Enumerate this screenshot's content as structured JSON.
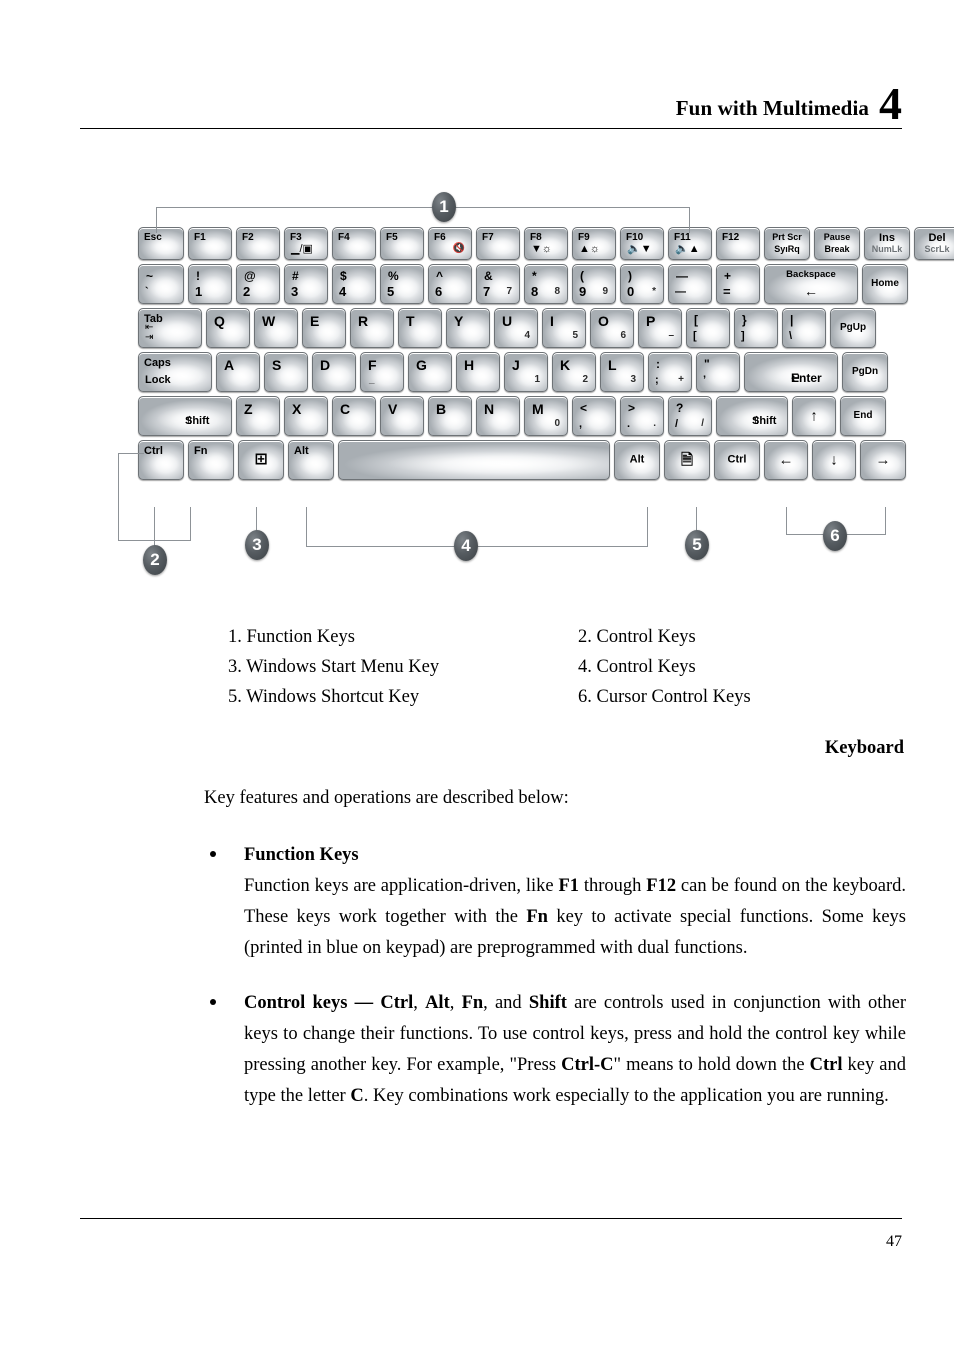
{
  "header": {
    "title": "Fun with Multimedia",
    "chapter": "4"
  },
  "footer": {
    "page_number": "47"
  },
  "figure": {
    "caption": "Keyboard",
    "callouts": [
      "1",
      "2",
      "3",
      "4",
      "5",
      "6"
    ],
    "keyboard": {
      "row_fn": [
        {
          "name": "esc",
          "main": "Esc"
        },
        {
          "name": "f1",
          "main": "F1"
        },
        {
          "name": "f2",
          "main": "F2"
        },
        {
          "name": "f3",
          "main": "F3",
          "icon": "display-switch"
        },
        {
          "name": "f4",
          "main": "F4"
        },
        {
          "name": "f5",
          "main": "F5"
        },
        {
          "name": "f6",
          "main": "F6",
          "icon": "speaker-mute"
        },
        {
          "name": "f7",
          "main": "F7"
        },
        {
          "name": "f8",
          "main": "F8",
          "icon": "brightness-down"
        },
        {
          "name": "f9",
          "main": "F9",
          "icon": "brightness-up"
        },
        {
          "name": "f10",
          "main": "F10",
          "icon": "volume-down"
        },
        {
          "name": "f11",
          "main": "F11",
          "icon": "volume-up"
        },
        {
          "name": "f12",
          "main": "F12"
        },
        {
          "name": "prtscr",
          "top": "Prt Scr",
          "bottom": "SyıRq"
        },
        {
          "name": "pause",
          "top": "Pause",
          "bottom": "Break"
        },
        {
          "name": "insert",
          "top": "Ins",
          "bottom": "NumLk"
        },
        {
          "name": "delete",
          "top": "Del",
          "bottom": "ScrLk"
        }
      ],
      "row_num": [
        {
          "name": "tilde",
          "top": "~",
          "bottom": "`"
        },
        {
          "name": "key-1",
          "top": "!",
          "bottom": "1"
        },
        {
          "name": "key-2",
          "top": "@",
          "bottom": "2"
        },
        {
          "name": "key-3",
          "top": "#",
          "bottom": "3"
        },
        {
          "name": "key-4",
          "top": "$",
          "bottom": "4"
        },
        {
          "name": "key-5",
          "top": "%",
          "bottom": "5"
        },
        {
          "name": "key-6",
          "top": "^",
          "bottom": "6"
        },
        {
          "name": "key-7",
          "top": "&",
          "bottom": "7",
          "alt": "7"
        },
        {
          "name": "key-8",
          "top": "*",
          "bottom": "8",
          "alt": "8"
        },
        {
          "name": "key-9",
          "top": "(",
          "bottom": "9",
          "alt": "9"
        },
        {
          "name": "key-0",
          "top": ")",
          "bottom": "0",
          "alt": "*"
        },
        {
          "name": "minus",
          "top": "—",
          "bottom": "—"
        },
        {
          "name": "equal",
          "top": "+",
          "bottom": "="
        },
        {
          "name": "backspace",
          "main": "Backspace",
          "icon": "arrow-left"
        },
        {
          "name": "home",
          "main": "Home"
        }
      ],
      "row_q": [
        {
          "name": "tab",
          "main": "Tab",
          "icon": "tab-arrows"
        },
        {
          "name": "key-q",
          "main": "Q"
        },
        {
          "name": "key-w",
          "main": "W"
        },
        {
          "name": "key-e",
          "main": "E"
        },
        {
          "name": "key-r",
          "main": "R"
        },
        {
          "name": "key-t",
          "main": "T"
        },
        {
          "name": "key-y",
          "main": "Y"
        },
        {
          "name": "key-u",
          "main": "U",
          "alt": "4"
        },
        {
          "name": "key-i",
          "main": "I",
          "alt": "5"
        },
        {
          "name": "key-o",
          "main": "O",
          "alt": "6"
        },
        {
          "name": "key-p",
          "main": "P",
          "alt": "–"
        },
        {
          "name": "bracket-left",
          "top": "[",
          "bottom": "["
        },
        {
          "name": "bracket-right",
          "top": "}",
          "bottom": "]"
        },
        {
          "name": "backslash",
          "top": "|",
          "bottom": "\\"
        },
        {
          "name": "pgup",
          "main": "PgUp"
        }
      ],
      "row_a": [
        {
          "name": "capslock",
          "top": "Caps",
          "bottom": "Lock"
        },
        {
          "name": "key-a",
          "main": "A"
        },
        {
          "name": "key-s",
          "main": "S"
        },
        {
          "name": "key-d",
          "main": "D"
        },
        {
          "name": "key-f",
          "main": "F",
          "alt": "_"
        },
        {
          "name": "key-g",
          "main": "G"
        },
        {
          "name": "key-h",
          "main": "H"
        },
        {
          "name": "key-j",
          "main": "J",
          "alt": "1"
        },
        {
          "name": "key-k",
          "main": "K",
          "alt": "2"
        },
        {
          "name": "key-l",
          "main": "L",
          "alt": "3"
        },
        {
          "name": "semicolon",
          "top": ":",
          "bottom": ";",
          "alt": "+"
        },
        {
          "name": "quote",
          "top": "\"",
          "bottom": "’"
        },
        {
          "name": "enter",
          "main": "Enter",
          "icon": "enter-arrow"
        },
        {
          "name": "pgdn",
          "main": "PgDn"
        }
      ],
      "row_z": [
        {
          "name": "shift-left",
          "main": "Shift",
          "icon": "shift-arrow"
        },
        {
          "name": "key-z",
          "main": "Z"
        },
        {
          "name": "key-x",
          "main": "X"
        },
        {
          "name": "key-c",
          "main": "C"
        },
        {
          "name": "key-v",
          "main": "V"
        },
        {
          "name": "key-b",
          "main": "B"
        },
        {
          "name": "key-n",
          "main": "N"
        },
        {
          "name": "key-m",
          "main": "M",
          "alt": "0"
        },
        {
          "name": "comma",
          "top": "<",
          "bottom": ","
        },
        {
          "name": "period",
          "top": ">",
          "bottom": ".",
          "alt": "."
        },
        {
          "name": "slash",
          "top": "?",
          "bottom": "/",
          "alt": "/"
        },
        {
          "name": "shift-right",
          "main": "Shift",
          "icon": "shift-arrow"
        },
        {
          "name": "arrow-up",
          "main": "↑"
        },
        {
          "name": "end",
          "main": "End"
        }
      ],
      "row_ctrl": [
        {
          "name": "ctrl-left",
          "main": "Ctrl"
        },
        {
          "name": "fn",
          "main": "Fn"
        },
        {
          "name": "windows",
          "icon": "windows-logo"
        },
        {
          "name": "alt-left",
          "main": "Alt"
        },
        {
          "name": "spacebar",
          "main": ""
        },
        {
          "name": "alt-right",
          "main": "Alt"
        },
        {
          "name": "menu",
          "icon": "context-menu"
        },
        {
          "name": "ctrl-right",
          "main": "Ctrl"
        },
        {
          "name": "arrow-left",
          "main": "←"
        },
        {
          "name": "arrow-down",
          "main": "↓"
        },
        {
          "name": "arrow-right",
          "main": "→"
        }
      ]
    },
    "legend": [
      {
        "num": "1",
        "text": "1. Function Keys"
      },
      {
        "num": "2",
        "text": "2. Control Keys"
      },
      {
        "num": "3",
        "text": "3. Windows Start Menu Key"
      },
      {
        "num": "4",
        "text": "4. Control Keys"
      },
      {
        "num": "5",
        "text": "5. Windows Shortcut Key"
      },
      {
        "num": "6",
        "text": "6. Cursor Control Keys"
      }
    ]
  },
  "content": {
    "intro": "Key features and operations are described below:",
    "bullets": [
      {
        "heading": "Function Keys",
        "body_html": "Function keys are application-driven, like <b>F1</b> through <b>F12</b> can be found on the keyboard. These keys work together with the <b>Fn</b> key to activate special functions. Some keys (printed in blue on keypad) are preprogrammed with dual functions."
      },
      {
        "heading": "",
        "body_html": "<b>Control keys &mdash; Ctrl</b>, <b>Alt</b>, <b>Fn</b>, and <b>Shift</b> are controls used in conjunction with other keys to change their functions. To use control keys, press and hold the control key while pressing another key. For example, \"Press <b>Ctrl-C</b>\" means to hold down the <b>Ctrl</b> key and type the letter <b>C</b>. Key combinations work especially to the application you are running."
      }
    ]
  }
}
